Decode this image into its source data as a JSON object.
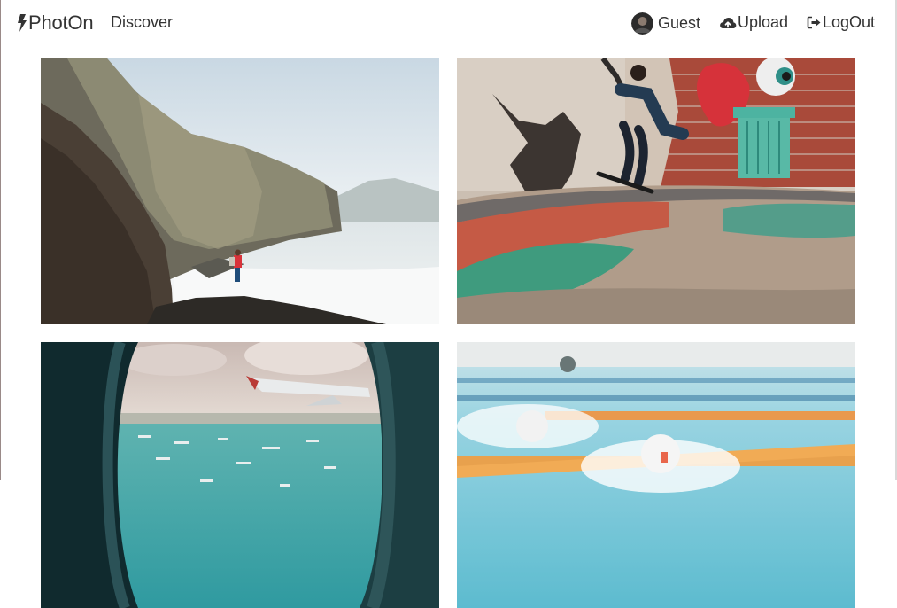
{
  "navbar": {
    "brand": "PhotOn",
    "links": {
      "discover": "Discover",
      "guest": "Guest",
      "upload": "Upload",
      "logout": "LogOut"
    },
    "icons": {
      "brand": "bolt-icon",
      "guest": "avatar",
      "upload": "cloud-upload-icon",
      "logout": "sign-out-icon"
    }
  },
  "gallery": {
    "photos": [
      {
        "subject": "hiker-on-coastal-cliff"
      },
      {
        "subject": "skateboarder-grinding-bowl-with-graffiti"
      },
      {
        "subject": "airplane-window-view-over-sea"
      },
      {
        "subject": "swimmers-in-pool-lanes"
      }
    ]
  },
  "colors": {
    "text": "#333333",
    "background": "#ffffff"
  }
}
